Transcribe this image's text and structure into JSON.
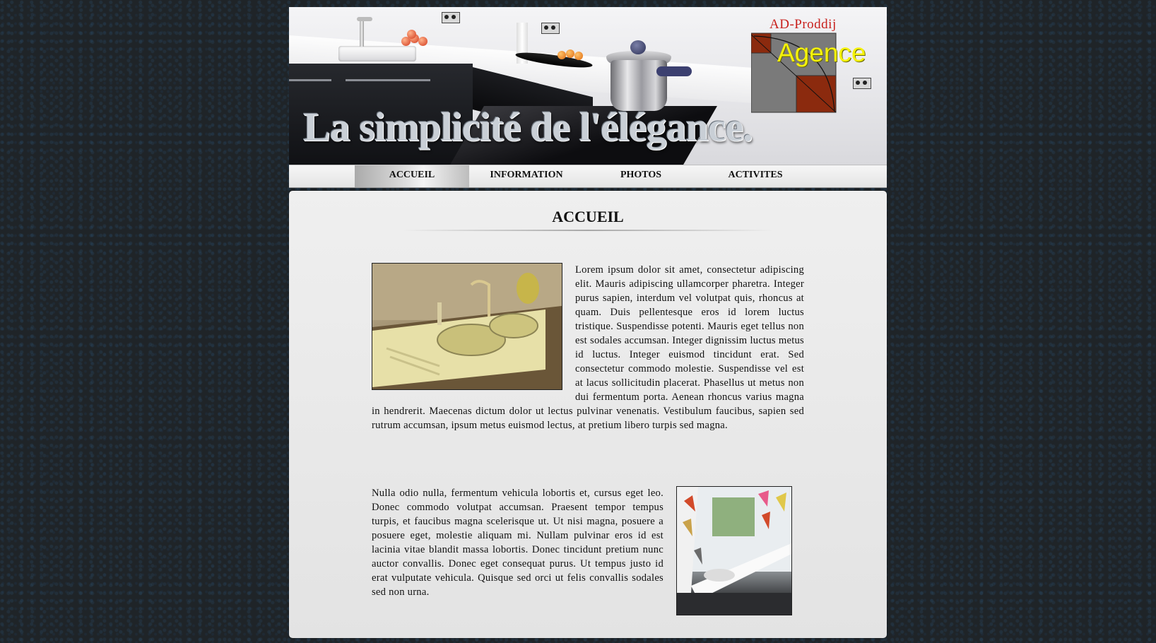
{
  "header": {
    "slogan": "La simplicité de l'élégance.",
    "logo": {
      "brand": "AD-Proddij",
      "word": "Agence"
    }
  },
  "nav": {
    "items": [
      {
        "label": "ACCUEIL",
        "active": true
      },
      {
        "label": "INFORMATION",
        "active": false
      },
      {
        "label": "PHOTOS",
        "active": false
      },
      {
        "label": "ACTIVITES",
        "active": false
      }
    ]
  },
  "main": {
    "title": "ACCUEIL",
    "paragraph_1": "Lorem ipsum dolor sit amet, consectetur adipiscing elit. Mauris adipiscing ullamcorper pharetra. Integer purus sapien, interdum vel volutpat quis, rhoncus at quam. Duis pellentesque eros id lorem luctus tristique. Suspendisse potenti. Mauris eget tellus non est sodales accumsan. Integer dignissim luctus metus id luctus. Integer euismod tincidunt erat. Sed consectetur commodo molestie. Suspendisse vel est at lacus sollicitudin placerat. Phasellus ut metus non dui fermentum porta. Aenean rhoncus varius magna in hendrerit. Maecenas dictum dolor ut lectus pulvinar venenatis. Vestibulum faucibus, sapien sed rutrum accumsan, ipsum metus euismod lectus, at pretium libero turpis sed magna.",
    "paragraph_2": "Nulla odio nulla, fermentum vehicula lobortis et, cursus eget leo. Donec commodo volutpat accumsan. Praesent tempor tempus turpis, et faucibus magna scelerisque ut. Ut nisi magna, posuere a posuere eget, molestie aliquam mi. Nullam pulvinar eros id est lacinia vitae blandit massa lobortis. Donec tincidunt pretium nunc auctor convallis. Donec eget consequat purus. Ut tempus justo id erat vulputate vehicula. Quisque sed orci ut felis convallis sodales sed non urna."
  },
  "colors": {
    "background": "#1f2428",
    "logo_red": "#c8201c",
    "logo_yellow": "#f5f20a",
    "logo_rust": "#8b2a0e",
    "logo_gray": "#7a7a7a"
  }
}
